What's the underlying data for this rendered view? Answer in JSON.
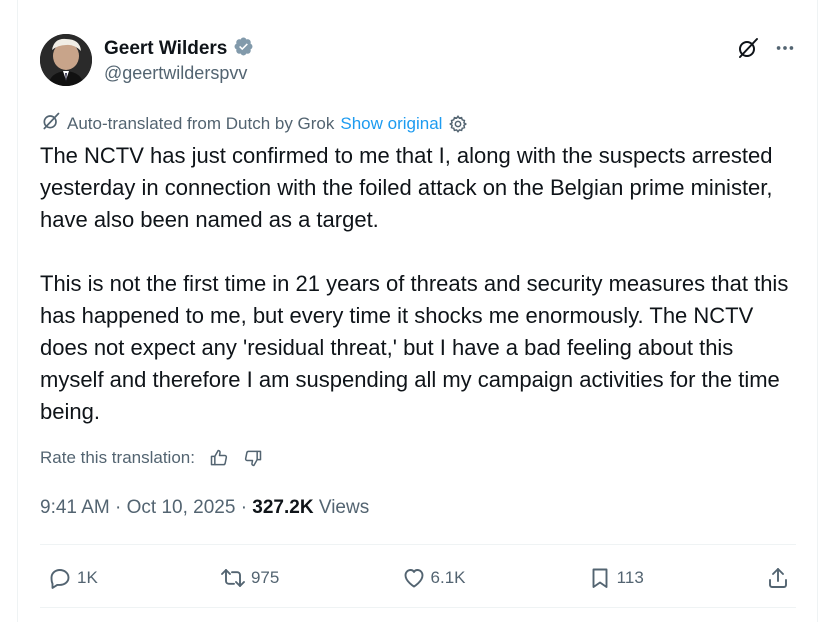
{
  "author": {
    "name": "Geert Wilders",
    "handle": "@geertwilderspvv",
    "verified_color": "#829aab"
  },
  "translation": {
    "note": "Auto-translated from Dutch by Grok",
    "show_original": "Show original"
  },
  "body": {
    "paragraph1": "The NCTV has just confirmed to me that I, along with the suspects arrested yesterday in connection with the foiled attack on the Belgian prime minister, have also been named as a target.",
    "paragraph2": "This is not the first time in 21 years of threats and security measures that this has happened to me, but every time it shocks me enormously. The NCTV does not expect any 'residual threat,' but I have a bad feeling about this myself and therefore I am suspending all my campaign activities for the time being."
  },
  "rating": {
    "label": "Rate this translation:"
  },
  "meta": {
    "time": "9:41 AM",
    "separator": "·",
    "date": "Oct 10, 2025",
    "views_count": "327.2K",
    "views_label": "Views"
  },
  "actions": {
    "replies": "1K",
    "reposts": "975",
    "likes": "6.1K",
    "bookmarks": "113"
  },
  "colors": {
    "text_primary": "#0f1419",
    "text_secondary": "#536471",
    "link": "#1d9bf0",
    "divider": "#eff3f4"
  }
}
